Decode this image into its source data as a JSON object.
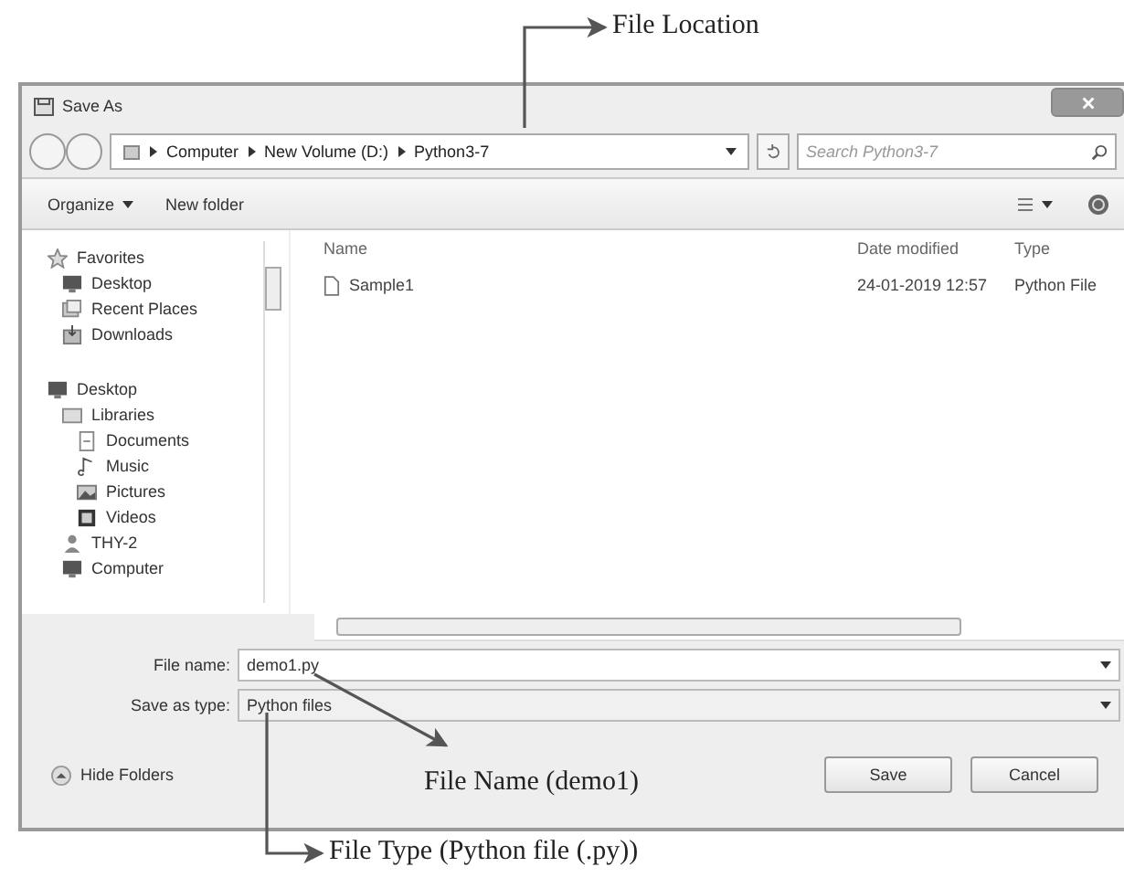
{
  "window": {
    "title": "Save As"
  },
  "address": {
    "crumbs": [
      "Computer",
      "New Volume (D:)",
      "Python3-7"
    ]
  },
  "search": {
    "placeholder": "Search Python3-7"
  },
  "toolbar": {
    "organize": "Organize",
    "new_folder": "New folder"
  },
  "sidebar": [
    {
      "label": "Favorites",
      "kind": "star",
      "children": [
        {
          "label": "Desktop",
          "kind": "monitor"
        },
        {
          "label": "Recent Places",
          "kind": "places"
        },
        {
          "label": "Downloads",
          "kind": "download"
        }
      ]
    },
    {
      "label": "Desktop",
      "kind": "monitor",
      "children": [
        {
          "label": "Libraries",
          "kind": "folder",
          "children": [
            {
              "label": "Documents",
              "kind": "document"
            },
            {
              "label": "Music",
              "kind": "music"
            },
            {
              "label": "Pictures",
              "kind": "picture"
            },
            {
              "label": "Videos",
              "kind": "video"
            }
          ]
        },
        {
          "label": "THY-2",
          "kind": "person"
        },
        {
          "label": "Computer",
          "kind": "computer"
        }
      ]
    }
  ],
  "table": {
    "columns": [
      "Name",
      "Date modified",
      "Type"
    ],
    "rows": [
      {
        "name": "Sample1",
        "date": "24-01-2019 12:57",
        "type": "Python File"
      }
    ]
  },
  "form": [
    {
      "label": "File name:",
      "value": "demo1.py"
    },
    {
      "label": "Save as type:",
      "value": "Python files"
    }
  ],
  "footer": {
    "hide_folders": "Hide Folders",
    "buttons": [
      "Save",
      "Cancel"
    ]
  },
  "annotations": [
    {
      "kind": "location",
      "text": "File Location"
    },
    {
      "kind": "name",
      "text": "File Name (demo1)"
    },
    {
      "kind": "type",
      "text": "File Type (Python file (.py))"
    }
  ]
}
